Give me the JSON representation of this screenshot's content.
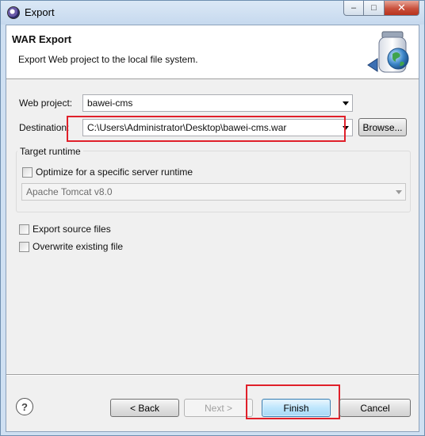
{
  "window": {
    "title": "Export",
    "minimize_glyph": "–",
    "maximize_glyph": "□",
    "close_glyph": "✕"
  },
  "banner": {
    "title": "WAR Export",
    "description": "Export Web project to the local file system.",
    "icon": "war-export-jar-globe-icon"
  },
  "form": {
    "web_project_label": "Web project:",
    "web_project_value": "bawei-cms",
    "destination_label": "Destination:",
    "destination_value": "C:\\Users\\Administrator\\Desktop\\bawei-cms.war",
    "browse_label": "Browse...",
    "target_runtime_title": "Target runtime",
    "optimize_label": "Optimize for a specific server runtime",
    "optimize_checked": false,
    "runtime_value": "Apache Tomcat v8.0",
    "export_source_label": "Export source files",
    "export_source_checked": false,
    "overwrite_label": "Overwrite existing file",
    "overwrite_checked": false
  },
  "footer": {
    "help_glyph": "?",
    "back_label": "< Back",
    "next_label": "Next >",
    "finish_label": "Finish",
    "cancel_label": "Cancel"
  },
  "colors": {
    "highlight": "#e0202a",
    "default_button": "#a7d9f5"
  }
}
